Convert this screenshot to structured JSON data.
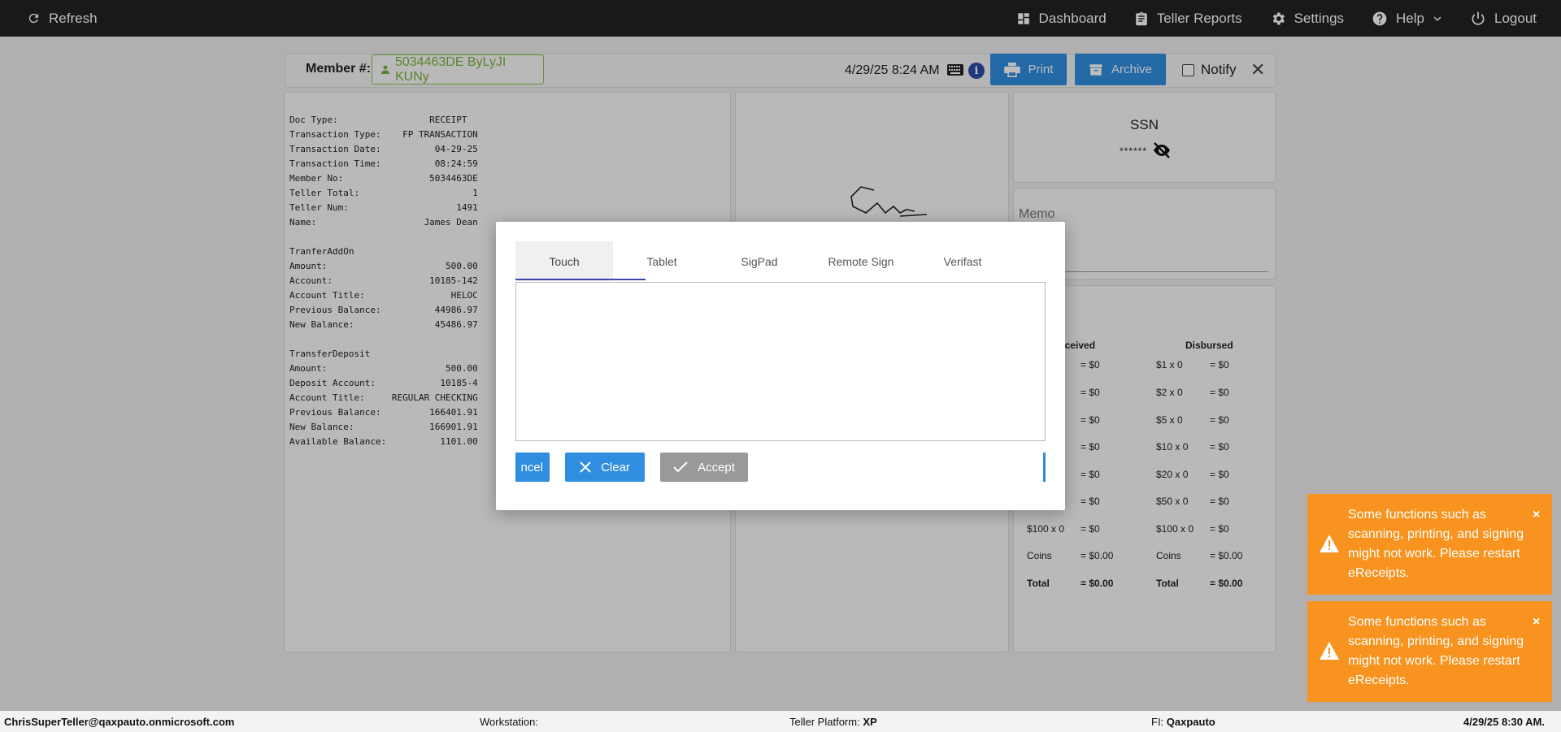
{
  "topbar": {
    "refresh_label": "Refresh",
    "nav": {
      "dashboard": "Dashboard",
      "teller_reports": "Teller Reports",
      "settings": "Settings",
      "help": "Help",
      "logout": "Logout"
    }
  },
  "member_bar": {
    "label": "Member #:",
    "member_value": "5034463DE ByLyJI KUNy",
    "datetime": "4/29/25 8:24 AM",
    "info": "i",
    "print_label": "Print",
    "archive_label": "Archive",
    "notify_label": "Notify",
    "close": "✕"
  },
  "receipt": {
    "lines": [
      "Doc Type:                 RECEIPT",
      "Transaction Type:    FP TRANSACTION",
      "Transaction Date:          04-29-25",
      "Transaction Time:          08:24:59",
      "Member No:                5034463DE",
      "Teller Total:                     1",
      "Teller Num:                    1491",
      "Name:                    James Dean",
      "",
      "TranferAddOn",
      "Amount:                      500.00",
      "Account:                  10185-142",
      "Account Title:                HELOC",
      "Previous Balance:          44986.97",
      "New Balance:               45486.97",
      "",
      "TransferDeposit",
      "Amount:                      500.00",
      "Deposit Account:            10185-4",
      "Account Title:     REGULAR CHECKING",
      "Previous Balance:         166401.91",
      "New Balance:              166901.91",
      "Available Balance:          1101.00"
    ]
  },
  "ssn": {
    "title": "SSN",
    "masked": "******"
  },
  "memo": {
    "label": "Memo"
  },
  "cash": {
    "received_header": "eceived",
    "disbursed_header": "Disbursed",
    "received": [
      {
        "denom": "",
        "value": "= $0"
      },
      {
        "denom": "",
        "value": "= $0"
      },
      {
        "denom": "",
        "value": "= $0"
      },
      {
        "denom": "",
        "value": "= $0"
      },
      {
        "denom": "",
        "value": "= $0"
      },
      {
        "denom": "",
        "value": "= $0"
      },
      {
        "denom": "$100 x 0",
        "value": "= $0"
      },
      {
        "denom": "Coins",
        "value": "= $0.00"
      },
      {
        "denom": "Total",
        "value": "= $0.00"
      }
    ],
    "disbursed": [
      {
        "denom": "$1 x 0",
        "value": "= $0"
      },
      {
        "denom": "$2 x 0",
        "value": "= $0"
      },
      {
        "denom": "$5 x 0",
        "value": "= $0"
      },
      {
        "denom": "$10 x 0",
        "value": "= $0"
      },
      {
        "denom": "$20 x 0",
        "value": "= $0"
      },
      {
        "denom": "$50 x 0",
        "value": "= $0"
      },
      {
        "denom": "$100 x 0",
        "value": "= $0"
      },
      {
        "denom": "Coins",
        "value": "= $0.00"
      },
      {
        "denom": "Total",
        "value": "= $0.00"
      }
    ]
  },
  "modal": {
    "tabs": [
      "Touch",
      "Tablet",
      "SigPad",
      "Remote Sign",
      "Verifast"
    ],
    "active_tab": "Touch",
    "cancel_label": "ncel",
    "clear_label": "Clear",
    "accept_label": "Accept"
  },
  "toasts": [
    {
      "text": "Some functions such as scanning, printing, and signing might not work. Please restart eReceipts.",
      "close": "×"
    },
    {
      "text": "Some functions such as scanning, printing, and signing might not work. Please restart eReceipts.",
      "close": "×"
    }
  ],
  "footer": {
    "user": "ChrisSuperTeller@qaxpauto.onmicrosoft.com",
    "workstation_label": "Workstation:",
    "workstation_value": "",
    "platform_label": "Teller Platform:",
    "platform_value": "XP",
    "fi_label": "FI:",
    "fi_value": "Qaxpauto",
    "datetime": "4/29/25 8:30 AM."
  },
  "colors": {
    "topbar": "#222222",
    "primary_button": "#2f8ee0",
    "toast": "#f7931e",
    "member_green": "#7cb342",
    "tab_underline": "#3949ab"
  }
}
